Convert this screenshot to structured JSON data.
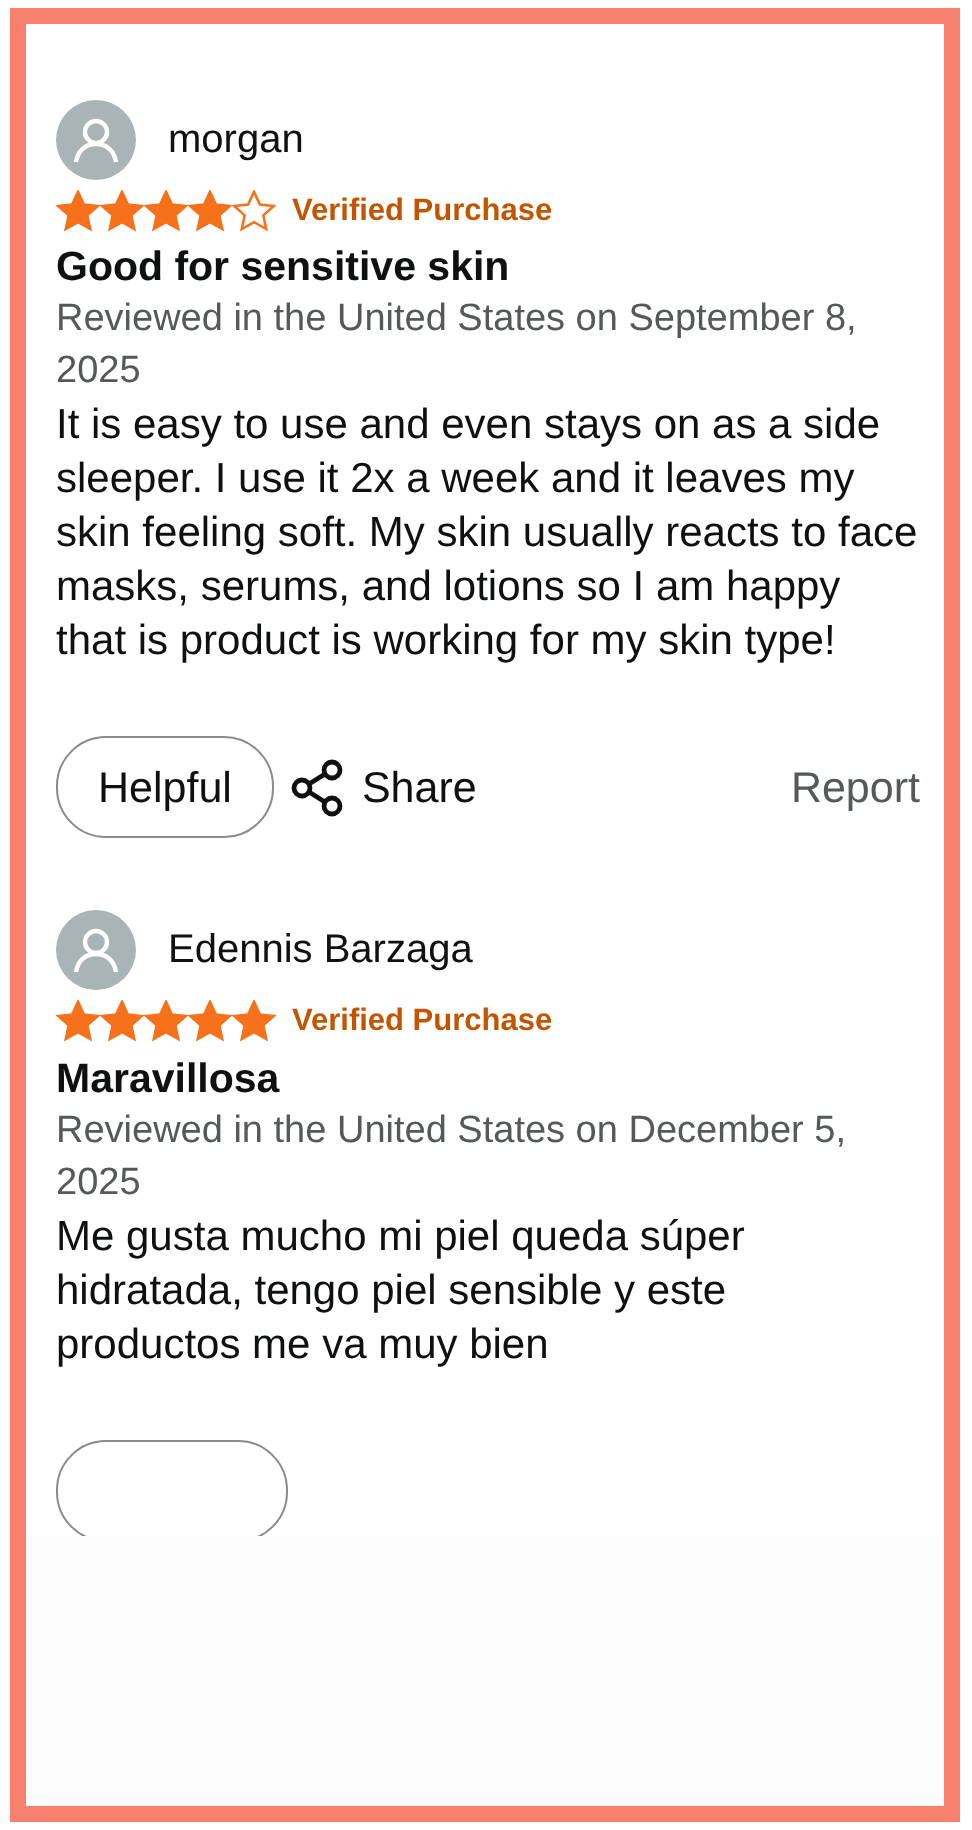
{
  "reviews": [
    {
      "author": "morgan",
      "stars": 4,
      "badge": "Verified Purchase",
      "title": "Good for sensitive skin",
      "date": "Reviewed in the United States on September 8, 2025",
      "body": "It is easy to use and even stays on as a side sleeper. I use it 2x a week and it leaves my skin feeling soft. My skin usually reacts to face masks, serums, and lotions so I am happy that is product is working for my skin type!",
      "actions": {
        "helpful": "Helpful",
        "share": "Share",
        "report": "Report"
      }
    },
    {
      "author": "Edennis Barzaga",
      "stars": 5,
      "badge": "Verified Purchase",
      "title": "Maravillosa",
      "date": "Reviewed in the United States on December 5, 2025",
      "body": "Me gusta mucho mi piel queda súper hidratada, tengo piel sensible y este productos me va muy bien",
      "actions_cut": true
    }
  ]
}
